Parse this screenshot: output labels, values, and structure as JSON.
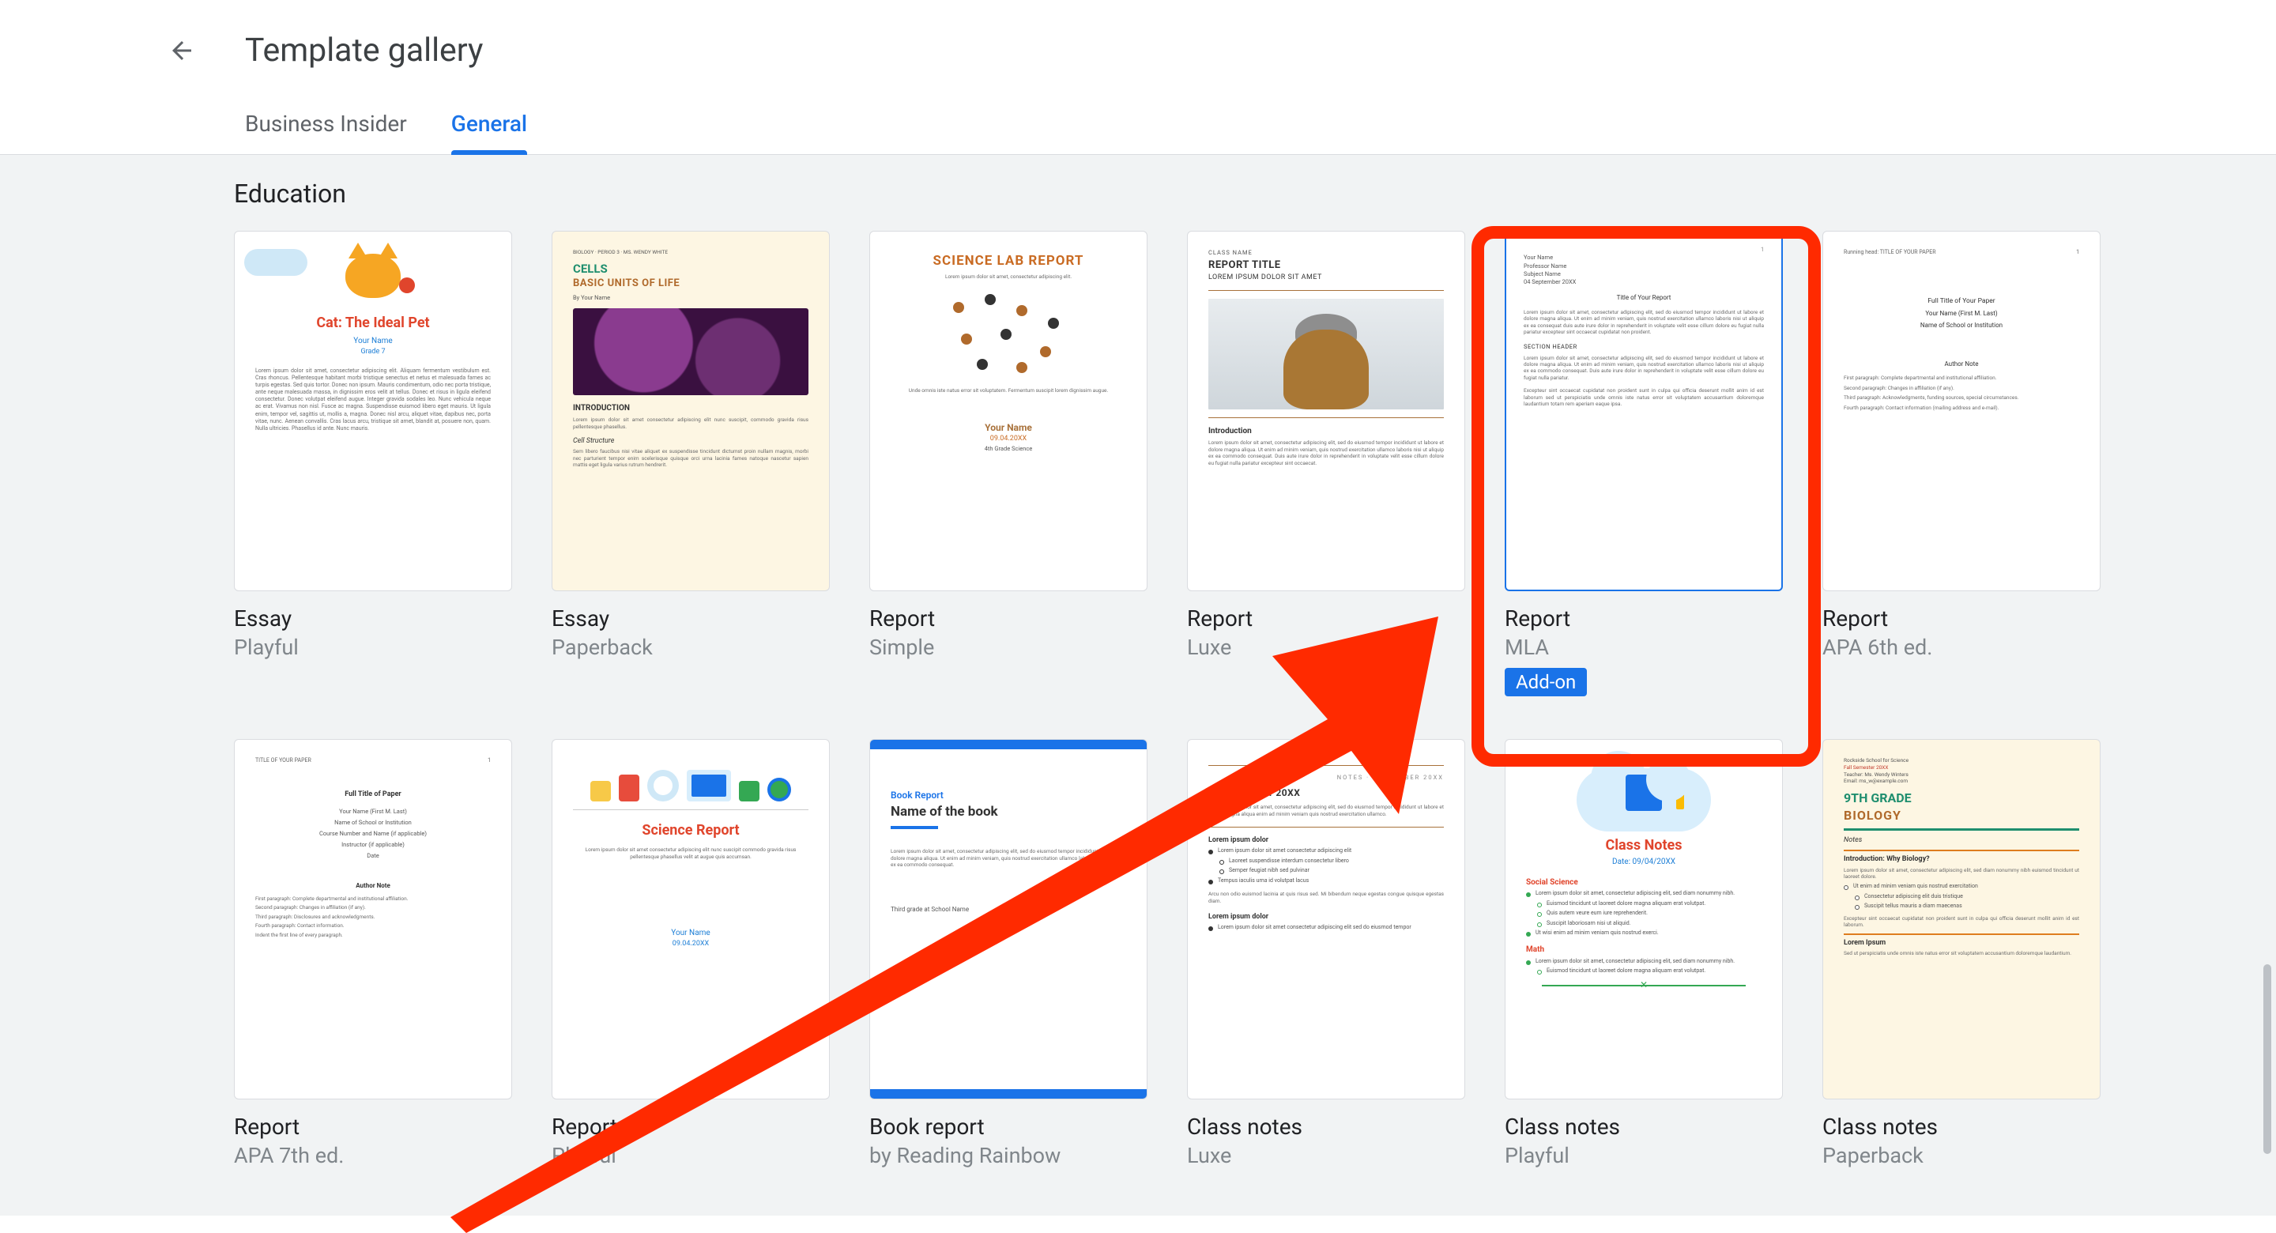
{
  "header": {
    "title": "Template gallery"
  },
  "tabs": [
    {
      "id": "bi",
      "label": "Business Insider",
      "active": false
    },
    {
      "id": "general",
      "label": "General",
      "active": true
    }
  ],
  "section": {
    "label": "Education"
  },
  "addon_label": "Add-on",
  "templates": [
    {
      "id": "essay-playful",
      "title": "Essay",
      "subtitle": "Playful",
      "preview": {
        "kind": "cat",
        "pet_title": "Cat: The Ideal Pet",
        "author": "Your Name",
        "grade": "Grade 7"
      }
    },
    {
      "id": "essay-paperback",
      "title": "Essay",
      "subtitle": "Paperback",
      "preview": {
        "kind": "cells",
        "tag": "BIOLOGY · PERIOD 3 · MS. WENDY WHITE",
        "h1": "CELLS",
        "h2": "BASIC UNITS OF LIFE",
        "by": "By Your Name",
        "intro": "INTRODUCTION",
        "struct": "Cell Structure"
      }
    },
    {
      "id": "report-simple",
      "title": "Report",
      "subtitle": "Simple",
      "preview": {
        "kind": "dots",
        "h1": "SCIENCE LAB REPORT",
        "author": "Your Name",
        "date": "09.04.20XX"
      }
    },
    {
      "id": "report-luxe",
      "title": "Report",
      "subtitle": "Luxe",
      "preview": {
        "kind": "luxe",
        "class": "CLASS NAME",
        "h1": "REPORT TITLE",
        "h2": "LOREM IPSUM DOLOR SIT AMET",
        "intro": "Introduction"
      }
    },
    {
      "id": "report-mla",
      "title": "Report",
      "subtitle": "MLA",
      "selected": true,
      "addon": true,
      "preview": {
        "kind": "mla",
        "l1": "Your Name",
        "l2": "Professor Name",
        "l3": "Subject Name",
        "l4": "04 September 20XX",
        "tcenter": "Title of Your Report",
        "sec": "SECTION HEADER"
      }
    },
    {
      "id": "report-apa6",
      "title": "Report",
      "subtitle": "APA 6th ed.",
      "preview": {
        "kind": "apa",
        "runhead": "Running head: TITLE OF YOUR PAPER",
        "pg": "1",
        "l1": "Full Title of Your Paper",
        "l2": "Your Name (First M. Last)",
        "l3": "Name of School or Institution",
        "an": "Author Note",
        "p1": "First paragraph: Complete departmental and institutional affiliation.",
        "p2": "Second paragraph: Changes in affiliation (if any).",
        "p3": "Third paragraph: Acknowledgments, funding sources, special circumstances.",
        "p4": "Fourth paragraph: Contact information (mailing address and e-mail)."
      }
    },
    {
      "id": "report-apa7",
      "title": "Report",
      "subtitle": "APA 7th ed.",
      "preview": {
        "kind": "apa7",
        "runhead": "TITLE OF YOUR PAPER",
        "pg": "1",
        "l1": "Full Title of Paper",
        "l2": "Your Name (First M. Last)",
        "l3": "Name of School or Institution",
        "l4": "Course Number and Name (if applicable)",
        "l5": "Instructor (if applicable)",
        "l6": "Date",
        "an": "Author Note",
        "p1": "First paragraph: Complete departmental and institutional affiliation.",
        "p2": "Second paragraph: Changes in affiliation (if any).",
        "p3": "Third paragraph: Disclosures and acknowledgments.",
        "p4": "Fourth paragraph: Contact information.",
        "p5": "Indent the first line of every paragraph."
      }
    },
    {
      "id": "report-playful2",
      "title": "Report",
      "subtitle": "Playful",
      "preview": {
        "kind": "science-playful",
        "h1": "Science Report",
        "author": "Your Name",
        "date": "09.04.20XX"
      }
    },
    {
      "id": "book-report",
      "title": "Book report",
      "subtitle": "by Reading Rainbow",
      "preview": {
        "kind": "bookreport",
        "tag": "Book Report",
        "h1": "Name of the book"
      }
    },
    {
      "id": "class-notes-luxe",
      "title": "Class notes",
      "subtitle": "Luxe",
      "preview": {
        "kind": "notes-luxe",
        "date": "04 September 20XX",
        "sec1": "Lorem ipsum dolor",
        "sec2": "Lorem ipsum dolor"
      }
    },
    {
      "id": "class-notes-playful",
      "title": "Class notes",
      "subtitle": "Playful",
      "preview": {
        "kind": "notes-playful",
        "h1": "Class Notes",
        "date": "Date: 09/04/20XX",
        "sec1": "Social Science",
        "sec2": "Math"
      }
    },
    {
      "id": "class-notes-paperback",
      "title": "Class notes",
      "subtitle": "Paperback",
      "preview": {
        "kind": "notes-paperback",
        "meta1": "Rockside School for Science",
        "meta2": "Fall Semester 20XX",
        "meta3": "Teacher: Ms. Wendy Winters",
        "meta4": "Email: ms_w@example.com",
        "h1": "9TH GRADE",
        "h2": "BIOLOGY",
        "notes": "Notes",
        "sec1": "Introduction: Why Biology?",
        "sec2": "Lorem Ipsum"
      }
    }
  ],
  "annotation": {
    "highlight_target": "report-mla"
  }
}
